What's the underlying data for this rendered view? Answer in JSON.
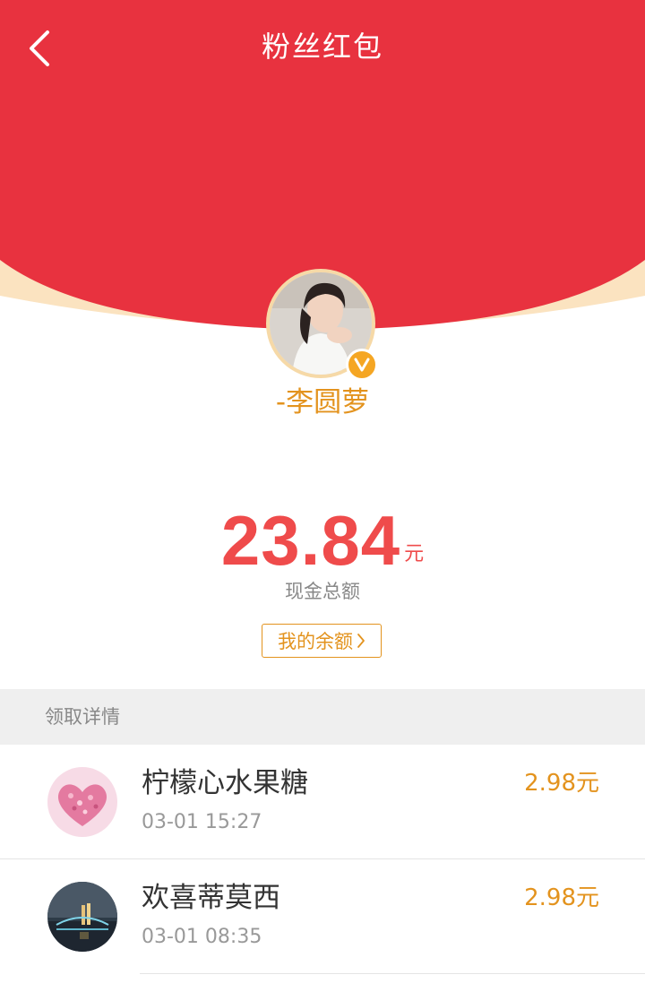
{
  "header": {
    "title": "粉丝红包",
    "back_icon": "chevron-left-icon"
  },
  "sender": {
    "name": "-李圆萝",
    "badge_letter": "V"
  },
  "amount": {
    "value": "23.84",
    "unit": "元",
    "label": "现金总额"
  },
  "balance_button": {
    "label": "我的余额"
  },
  "details": {
    "section_title": "领取详情",
    "items": [
      {
        "name": "柠檬心水果糖",
        "time": "03-01 15:27",
        "amount": "2.98元"
      },
      {
        "name": "欢喜蒂莫西",
        "time": "03-01 08:35",
        "amount": "2.98元"
      }
    ]
  },
  "colors": {
    "envelope_red": "#e8323f",
    "envelope_rim": "#fbe3c0",
    "accent_orange": "#e3931e",
    "amount_red": "#ef4b4b",
    "section_bg": "#efefef"
  }
}
